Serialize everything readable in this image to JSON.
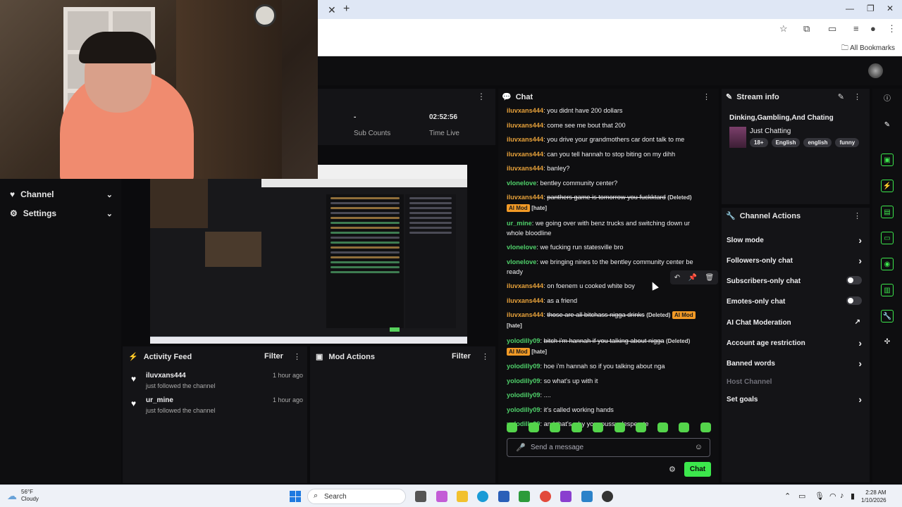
{
  "browser": {
    "close_tab": "✕",
    "new_tab": "+",
    "all_bookmarks": "All Bookmarks"
  },
  "left_nav": {
    "items": [
      {
        "label": "Channel",
        "icon": "heart-icon"
      },
      {
        "label": "Settings",
        "icon": "gear-icon"
      }
    ]
  },
  "stats": {
    "sub_counts_value": "-",
    "sub_counts_label": "Sub Counts",
    "time_live_value": "02:52:56",
    "time_live_label": "Time Live"
  },
  "activity_feed": {
    "title": "Activity Feed",
    "filter": "Filter",
    "items": [
      {
        "name": "iluvxans444",
        "text": "just followed the channel",
        "time": "1 hour ago"
      },
      {
        "name": "ur_mine",
        "text": "just followed the channel",
        "time": "1 hour ago"
      }
    ]
  },
  "mod_actions": {
    "title": "Mod Actions",
    "filter": "Filter"
  },
  "chat": {
    "title": "Chat",
    "placeholder": "Send a message",
    "send_label": "Chat",
    "deleted_tag": "(Deleted)",
    "ai_mod_tag": "AI Mod",
    "hate_tag": "[hate]",
    "messages": [
      {
        "user": "iluvxans444",
        "color": "#e8a23a",
        "text": "you didnt have 200 dollars"
      },
      {
        "user": "iluvxans444",
        "color": "#e8a23a",
        "text": "come see me bout that 200"
      },
      {
        "user": "iluvxans444",
        "color": "#e8a23a",
        "text": "you drive your grandmothers car dont talk to me"
      },
      {
        "user": "iluvxans444",
        "color": "#e8a23a",
        "text": "can you tell hannah to stop biting on my dihh"
      },
      {
        "user": "iluvxans444",
        "color": "#e8a23a",
        "text": "banley?"
      },
      {
        "user": "vlonelove",
        "color": "#4fd06a",
        "text": "bentley community center?"
      },
      {
        "user": "iluvxans444",
        "color": "#e8a23a",
        "text": "panthers game is tomorrow you fuckktard",
        "deleted": true
      },
      {
        "user": "ur_mine",
        "color": "#4fd06a",
        "text": "we going over with benz trucks and switching down ur whole bloodline"
      },
      {
        "user": "vlonelove",
        "color": "#4fd06a",
        "text": "we fucking run statesville bro"
      },
      {
        "user": "vlonelove",
        "color": "#4fd06a",
        "text": "we bringing nines to the bentley community center be ready"
      },
      {
        "user": "iluvxans444",
        "color": "#e8a23a",
        "text": "on foenem u cooked white boy"
      },
      {
        "user": "iluvxans444",
        "color": "#e8a23a",
        "text": "as a friend"
      },
      {
        "user": "iluvxans444",
        "color": "#e8a23a",
        "text": "those are all bitchass nigga drinks",
        "deleted": true
      },
      {
        "user": "yolodilly09",
        "color": "#4fd06a",
        "text": "bitch i'm hannah if you talking about nigga",
        "deleted": true
      },
      {
        "user": "yolodilly09",
        "color": "#4fd06a",
        "text": "hoe i'm hannah so if you talking about nga"
      },
      {
        "user": "yolodilly09",
        "color": "#4fd06a",
        "text": "so what's up with it"
      },
      {
        "user": "yolodilly09",
        "color": "#4fd06a",
        "text": "...."
      },
      {
        "user": "yolodilly09",
        "color": "#4fd06a",
        "text": "it's called working hands"
      },
      {
        "user": "yolodilly09",
        "color": "#4fd06a",
        "text": "and that's why your pussy desperate"
      }
    ]
  },
  "stream_info": {
    "title_label": "Stream info",
    "stream_title": "Dinking,Gambling,And Chating",
    "category": "Just Chatting",
    "tags": [
      "18+",
      "English",
      "english",
      "funny"
    ]
  },
  "channel_actions": {
    "title": "Channel Actions",
    "items": [
      {
        "label": "Slow mode",
        "control": "arrow"
      },
      {
        "label": "Followers-only chat",
        "control": "arrow"
      },
      {
        "label": "Subscribers-only chat",
        "control": "toggle"
      },
      {
        "label": "Emotes-only chat",
        "control": "toggle"
      },
      {
        "label": "AI Chat Moderation",
        "control": "external"
      },
      {
        "label": "Account age restriction",
        "control": "arrow"
      },
      {
        "label": "Banned words",
        "control": "arrow"
      },
      {
        "label": "Host Channel",
        "control": "none",
        "disabled": true
      },
      {
        "label": "Set goals",
        "control": "arrow"
      }
    ]
  },
  "taskbar": {
    "weather_temp": "56°F",
    "weather_desc": "Cloudy",
    "search_label": "Search",
    "time": "2:28 AM",
    "date": "1/10/2026"
  },
  "colors": {
    "accent_green": "#3ce74c",
    "ai_mod_badge": "#f29a26"
  }
}
